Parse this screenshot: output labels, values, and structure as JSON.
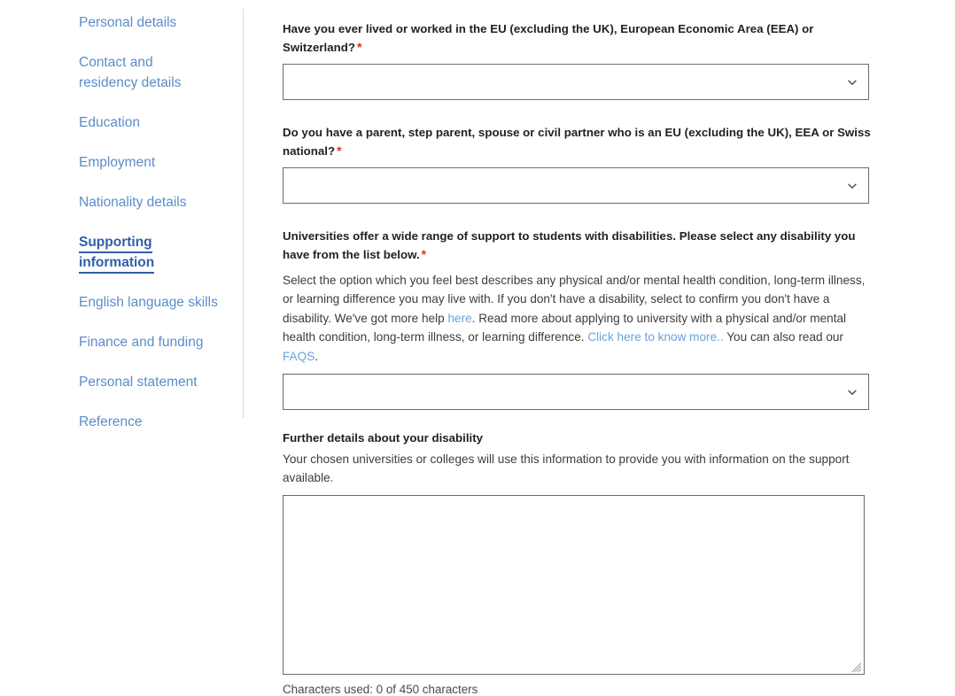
{
  "sidebar": {
    "items": [
      {
        "label": "Personal details",
        "active": false
      },
      {
        "label": "Contact and residency details",
        "active": false
      },
      {
        "label": "Education",
        "active": false
      },
      {
        "label": "Employment",
        "active": false
      },
      {
        "label": "Nationality details",
        "active": false
      },
      {
        "label": "Supporting information",
        "active": true
      },
      {
        "label": "English language skills",
        "active": false
      },
      {
        "label": "Finance and funding",
        "active": false
      },
      {
        "label": "Personal statement",
        "active": false
      },
      {
        "label": "Reference",
        "active": false
      }
    ]
  },
  "form": {
    "required_marker": "*",
    "chevron_icon": "chevron-down-icon",
    "questions": {
      "eu_residence": {
        "label": "Have you ever lived or worked in the EU (excluding the UK), European Economic Area (EEA) or Switzerland?",
        "value": "",
        "placeholder": ""
      },
      "eu_relative": {
        "label": "Do you have a parent, step parent, spouse or civil partner who is an EU (excluding the UK), EEA or Swiss national?",
        "value": "",
        "placeholder": ""
      },
      "disability": {
        "label": "Universities offer a wide range of support to students with disabilities. Please select any disability you have from the list below.",
        "help_part_1": "Select the option which you feel best describes any physical and/or mental health condition, long-term illness, or learning difference you may live with. If you don't have a disability, select to confirm you don't have a disability. We've got more help ",
        "link_here": "here",
        "help_part_2": ". Read more about applying to university with a physical and/or mental health condition, long-term illness, or learning difference. ",
        "link_know_more": "Click here to know more..",
        "help_part_3": " You can also read our ",
        "link_faqs": "FAQS",
        "help_part_4": ".",
        "value": "",
        "placeholder": ""
      },
      "further_details": {
        "label": "Further details about your disability",
        "help": "Your chosen universities or colleges will use this information to provide you with information on the support available.",
        "value": "",
        "placeholder": "",
        "counter": "Characters used: 0 of 450 characters"
      }
    }
  },
  "colors": {
    "link": "#5b8dc8",
    "link_active": "#2f5fa8",
    "inline_link": "#6aa3dc",
    "required": "#d4351c",
    "border": "#6b6b6b",
    "divider": "#d8d8d8",
    "text": "#231f20"
  }
}
